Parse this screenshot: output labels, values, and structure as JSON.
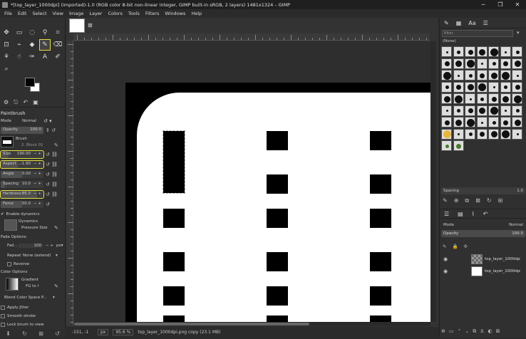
{
  "window": {
    "title": "*[top_layer_1000dpi] (imported)-1.0 (RGB color 8-bit non-linear integer, GIMP built-in sRGB, 2 layers) 1481x1324 – GIMP",
    "minimize": "─",
    "maximize": "❐",
    "close": "✕"
  },
  "menu": [
    "File",
    "Edit",
    "Select",
    "View",
    "Image",
    "Layer",
    "Colors",
    "Tools",
    "Filters",
    "Windows",
    "Help"
  ],
  "tool_options": {
    "title": "Paintbrush",
    "mode_label": "Mode",
    "mode_value": "Normal",
    "opacity_label": "Opacity",
    "opacity_value": "100.0",
    "brush_label": "Brush",
    "brush_value": "2. Block 01",
    "size_label": "Size",
    "size_value": "190.00",
    "aspect_label": "Aspect ...",
    "aspect_value": "-1.90",
    "angle_label": "Angle",
    "angle_value": "0.00",
    "spacing_label": "Spacing",
    "spacing_value": "10.0",
    "hardness_label": "Hardness",
    "hardness_value": "85.0",
    "force_label": "Force",
    "force_value": "50.0",
    "enable_dynamics": "Enable dynamics",
    "dynamics_label": "Dynamics",
    "dynamics_value": "Pressure Size",
    "fade_title": "Fade Options",
    "fade_label": "Fad...",
    "fade_value": "100",
    "fade_unit": "px",
    "repeat_label": "Repeat",
    "repeat_value": "None (extend)",
    "reverse_label": "Reverse",
    "color_title": "Color Options",
    "gradient_label": "Gradient",
    "gradient_value": "FG to I",
    "blend_label": "Blend Color Space P...",
    "apply_jitter": "Apply Jitter",
    "smooth_stroke": "Smooth stroke",
    "lock_brush": "Lock brush to view"
  },
  "status": {
    "coords": "-151, -1",
    "unit": "px",
    "zoom": "95.6 %",
    "info": "top_layer_1000dpi.png copy (23.1 MB)"
  },
  "brushes": {
    "filter_placeholder": "filter",
    "selected_name": "(None)",
    "spacing_label": "Spacing",
    "spacing_value": "1.0"
  },
  "layers": {
    "mode_label": "Mode",
    "mode_value": "Normal",
    "opacity_label": "Opacity",
    "opacity_value": "100.0",
    "items": [
      {
        "name": "top_layer_1000dpi.p"
      },
      {
        "name": "top_layer_1000dpi.p"
      }
    ]
  },
  "colors": {
    "accent_highlight": "#e6e040",
    "fg": "#000000",
    "bg": "#ffffff"
  }
}
